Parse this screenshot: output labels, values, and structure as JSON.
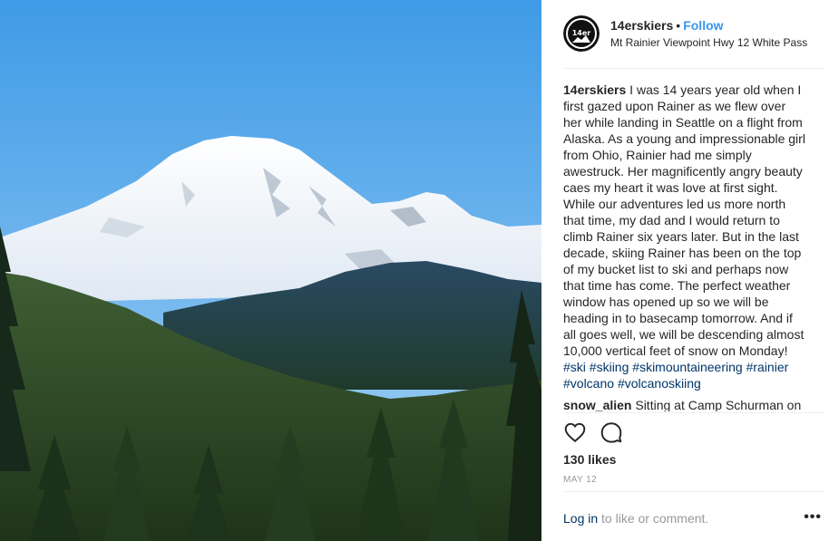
{
  "post": {
    "author": "14erskiers",
    "separator": "•",
    "follow_label": "Follow",
    "location": "Mt Rainier Viewpoint Hwy 12 White Pass",
    "avatar_text": "14er"
  },
  "caption": {
    "author": "14erskiers",
    "text": " I was 14 years year old when I first gazed upon Rainer as we flew over her while landing in Seattle on a flight from Alaska. As a young and impressionable girl from Ohio, Rainier had me simply awestruck. Her magnificently angry beauty caes my heart it was love at first sight. While our adventures led us more north that time, my dad and I would return to climb Rainer six years later. But in the last decade, skiing Rainer has been on the top of my bucket list to ski and perhaps now that time has come. The perfect weather window has opened up so we will be heading in to basecamp tomorrow. And if all goes well, we will be descending almost 10,000 vertical feet of snow on Monday! ",
    "hashtags": [
      "#ski",
      "#skiing",
      "#skimountaineering",
      "#rainier",
      "#volcano",
      "#volcanoskiing"
    ]
  },
  "comment": {
    "author": "snow_alien",
    "text": " Sitting at Camp Schurman on"
  },
  "actions": {
    "like_icon": "heart-icon",
    "comment_icon": "comment-icon",
    "likes": "130 likes",
    "date": "MAY 12"
  },
  "footer": {
    "login_label": "Log in",
    "login_suffix": " to like or comment.",
    "more_label": "•••"
  },
  "colors": {
    "link": "#3897f0",
    "hashtag": "#003569",
    "muted": "#999999"
  }
}
